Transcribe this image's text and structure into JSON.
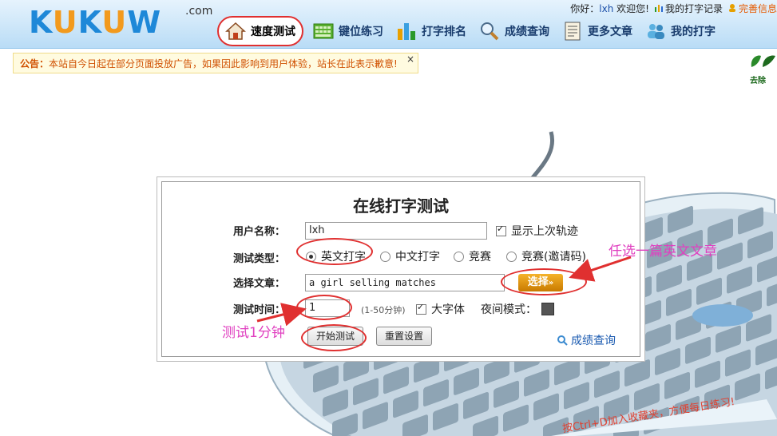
{
  "header": {
    "logo": "KUKUW",
    "logo_suffix": ".com",
    "greeting_prefix": "你好：",
    "username": "lxh",
    "welcome": "欢迎您!",
    "my_records": "我的打字记录",
    "complete_info": "完善信息"
  },
  "nav": {
    "items": [
      {
        "label": "速度测试",
        "icon": "home-icon"
      },
      {
        "label": "键位练习",
        "icon": "keyboard-icon"
      },
      {
        "label": "打字排名",
        "icon": "bar-chart-icon"
      },
      {
        "label": "成绩查询",
        "icon": "magnifier-icon"
      },
      {
        "label": "更多文章",
        "icon": "document-icon"
      },
      {
        "label": "我的打字",
        "icon": "users-icon"
      }
    ]
  },
  "notice": {
    "label": "公告：",
    "text": "本站自今日起在部分页面投放广告，如果因此影响到用户体验，站长在此表示歉意!",
    "close": "×"
  },
  "side_logo_text": "去除",
  "form": {
    "title": "在线打字测试",
    "username_label": "用户名称：",
    "username_value": "lxh",
    "show_track_label": "显示上次轨迹",
    "type_label": "测试类型：",
    "types": [
      "英文打字",
      "中文打字",
      "竞赛",
      "竞赛(邀请码)"
    ],
    "article_label": "选择文章：",
    "article_value": "a girl selling matches",
    "select_button": "选择",
    "time_label": "测试时间：",
    "time_value": "1",
    "time_hint": "(1-50分钟)",
    "big_font_label": "大字体",
    "night_mode_label": "夜间模式：",
    "start_button": "开始测试",
    "reset_button": "重置设置",
    "score_link": "成绩查询"
  },
  "annotations": {
    "article_note": "任选一篇英文文章",
    "time_note": "测试1分钟"
  },
  "keyboard_slogan": "按Ctrl+D加入收藏夹，方便每日练习!",
  "colors": {
    "accent": "#1e88d8",
    "annotation": "#e040c0",
    "circle": "#e03030",
    "notice_text": "#d05000"
  }
}
